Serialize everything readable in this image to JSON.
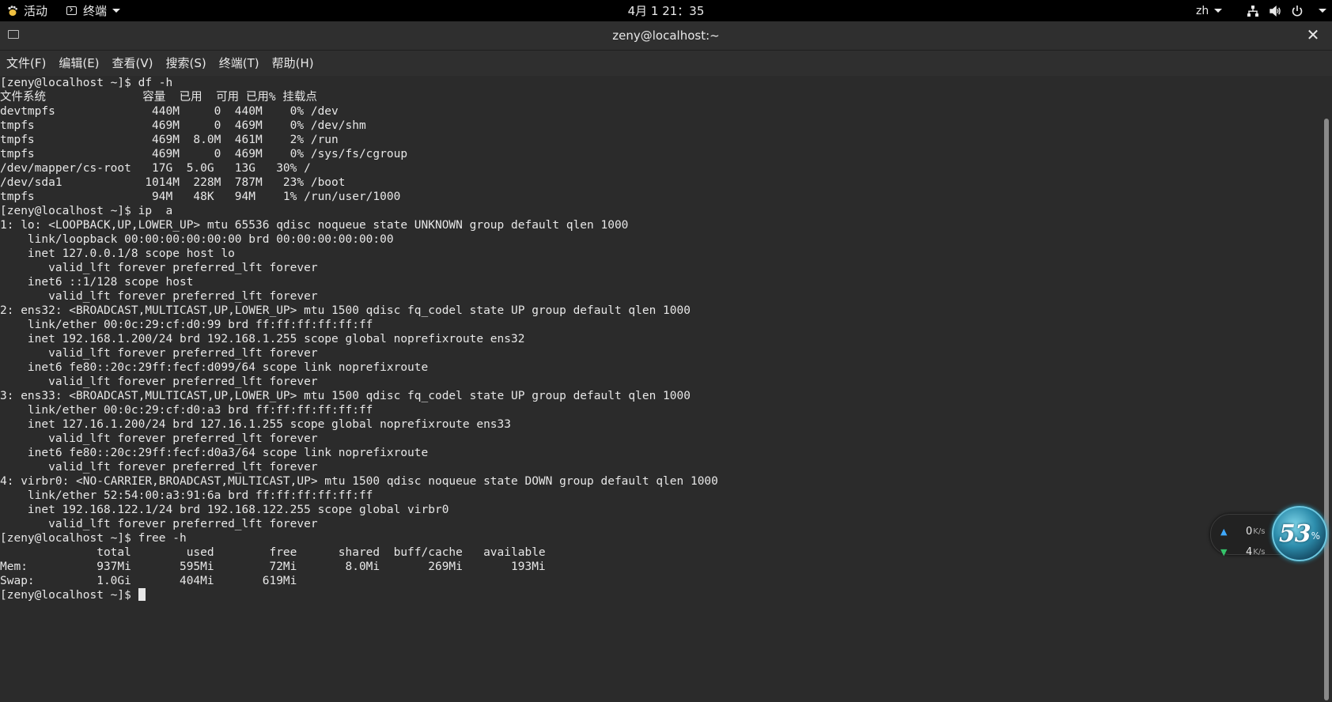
{
  "topbar": {
    "activities_label": "活动",
    "app_menu_label": "终端",
    "clock": "4月 1  21：35",
    "language": "zh",
    "icons": [
      "network-icon",
      "volume-icon",
      "power-icon"
    ]
  },
  "window": {
    "title": "zeny@localhost:~",
    "close_glyph": "✕"
  },
  "menubar": {
    "items": [
      "文件(F)",
      "编辑(E)",
      "查看(V)",
      "搜索(S)",
      "终端(T)",
      "帮助(H)"
    ]
  },
  "terminal": {
    "lines": [
      "[zeny@localhost ~]$ df -h",
      "文件系统              容量  已用  可用 已用% 挂载点",
      "devtmpfs              440M     0  440M    0% /dev",
      "tmpfs                 469M     0  469M    0% /dev/shm",
      "tmpfs                 469M  8.0M  461M    2% /run",
      "tmpfs                 469M     0  469M    0% /sys/fs/cgroup",
      "/dev/mapper/cs-root   17G  5.0G   13G   30% /",
      "/dev/sda1            1014M  228M  787M   23% /boot",
      "tmpfs                 94M   48K   94M    1% /run/user/1000",
      "[zeny@localhost ~]$ ip  a",
      "1: lo: <LOOPBACK,UP,LOWER_UP> mtu 65536 qdisc noqueue state UNKNOWN group default qlen 1000",
      "    link/loopback 00:00:00:00:00:00 brd 00:00:00:00:00:00",
      "    inet 127.0.0.1/8 scope host lo",
      "       valid_lft forever preferred_lft forever",
      "    inet6 ::1/128 scope host",
      "       valid_lft forever preferred_lft forever",
      "2: ens32: <BROADCAST,MULTICAST,UP,LOWER_UP> mtu 1500 qdisc fq_codel state UP group default qlen 1000",
      "    link/ether 00:0c:29:cf:d0:99 brd ff:ff:ff:ff:ff:ff",
      "    inet 192.168.1.200/24 brd 192.168.1.255 scope global noprefixroute ens32",
      "       valid_lft forever preferred_lft forever",
      "    inet6 fe80::20c:29ff:fecf:d099/64 scope link noprefixroute",
      "       valid_lft forever preferred_lft forever",
      "3: ens33: <BROADCAST,MULTICAST,UP,LOWER_UP> mtu 1500 qdisc fq_codel state UP group default qlen 1000",
      "    link/ether 00:0c:29:cf:d0:a3 brd ff:ff:ff:ff:ff:ff",
      "    inet 127.16.1.200/24 brd 127.16.1.255 scope global noprefixroute ens33",
      "       valid_lft forever preferred_lft forever",
      "    inet6 fe80::20c:29ff:fecf:d0a3/64 scope link noprefixroute",
      "       valid_lft forever preferred_lft forever",
      "4: virbr0: <NO-CARRIER,BROADCAST,MULTICAST,UP> mtu 1500 qdisc noqueue state DOWN group default qlen 1000",
      "    link/ether 52:54:00:a3:91:6a brd ff:ff:ff:ff:ff:ff",
      "    inet 192.168.122.1/24 brd 192.168.122.255 scope global virbr0",
      "       valid_lft forever preferred_lft forever",
      "[zeny@localhost ~]$ free -h",
      "              total        used        free      shared  buff/cache   available",
      "Mem:          937Mi       595Mi        72Mi       8.0Mi       269Mi       193Mi",
      "Swap:         1.0Gi       404Mi       619Mi",
      "[zeny@localhost ~]$ "
    ]
  },
  "net_widget": {
    "upload_value": "0",
    "upload_unit": "K/s",
    "download_value": "4",
    "download_unit": "K/s",
    "percent": "53",
    "percent_sign": "%"
  },
  "colors": {
    "topbar_bg": "#000000",
    "titlebar_bg": "#2f2f2f",
    "terminal_bg": "#2b2b2b",
    "terminal_fg": "#e7e7e7"
  }
}
